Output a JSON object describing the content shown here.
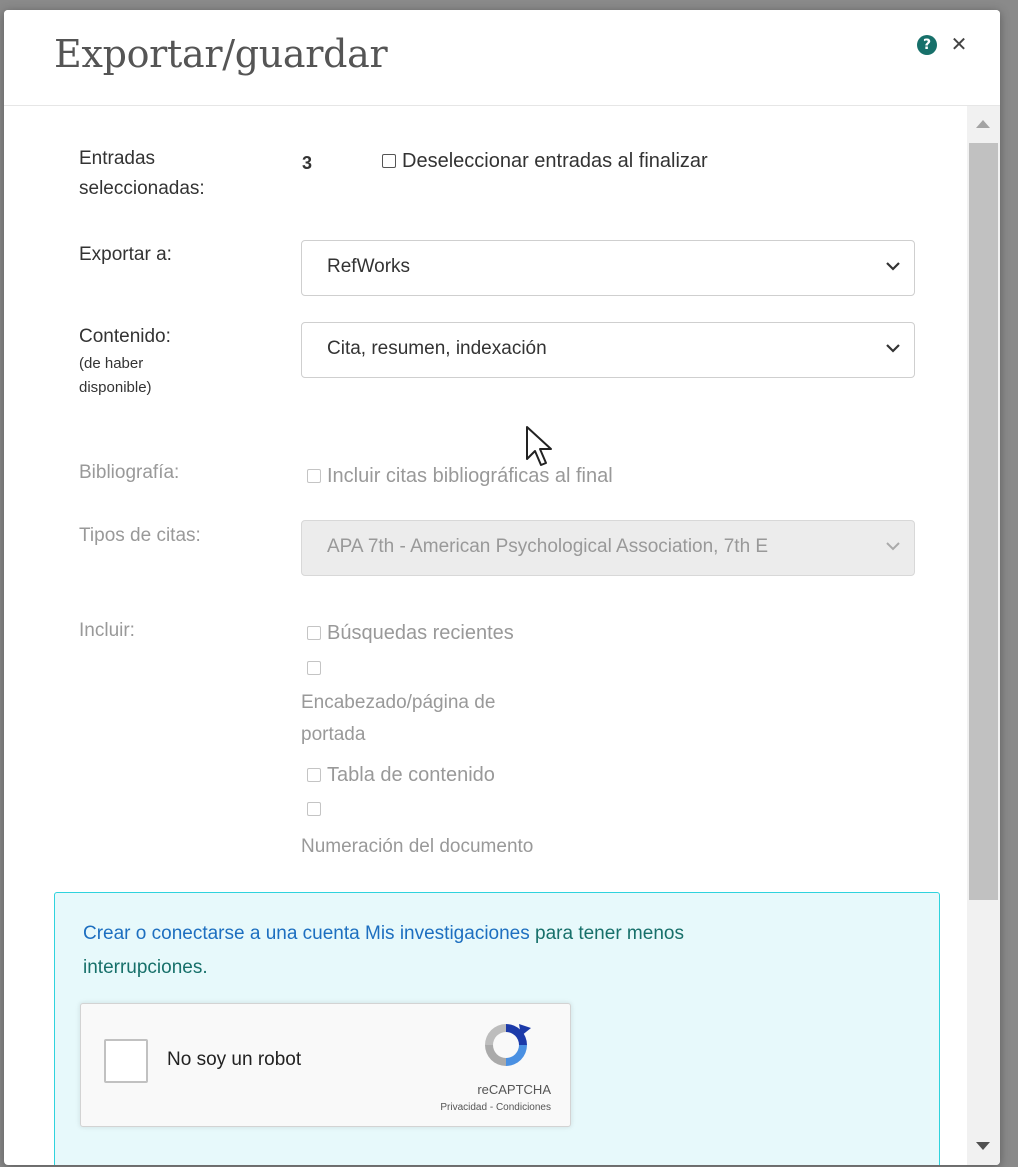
{
  "dialog": {
    "title": "Exportar/guardar",
    "help_icon": "question-circle-icon",
    "close_icon": "close-icon"
  },
  "form": {
    "selected": {
      "label_line1": "Entradas",
      "label_line2": "seleccionadas:",
      "count": "3",
      "deselect_label": "Deseleccionar entradas al finalizar",
      "deselect_checked": false
    },
    "export_to": {
      "label": "Exportar a:",
      "value": "RefWorks"
    },
    "content": {
      "label": "Contenido:",
      "sublabel_line1": "(de haber",
      "sublabel_line2": "disponible)",
      "value": "Cita, resumen, indexación"
    },
    "bibliography": {
      "label": "Bibliografía:",
      "option": "Incluir citas bibliográficas al final",
      "checked": false,
      "disabled": true
    },
    "citation_types": {
      "label": "Tipos de citas:",
      "value": "APA 7th - American Psychological Association, 7th E",
      "disabled": true
    },
    "include": {
      "label": "Incluir:",
      "options": [
        "Búsquedas recientes",
        "Encabezado/página de",
        "portada",
        "Tabla de contenido",
        "Numeración del documento"
      ]
    }
  },
  "info": {
    "link_text": "Crear o conectarse a una cuenta Mis investigaciones",
    "text_after": " para tener menos",
    "text_line2": "interrupciones."
  },
  "recaptcha": {
    "label": "No soy un robot",
    "brand": "reCAPTCHA",
    "privacy": "Privacidad",
    "separator": " - ",
    "terms": "Condiciones"
  },
  "colors": {
    "accent": "#17706a",
    "link": "#1d6fc0",
    "info_border": "#2fd3dd",
    "info_bg": "#e7f9fb"
  }
}
